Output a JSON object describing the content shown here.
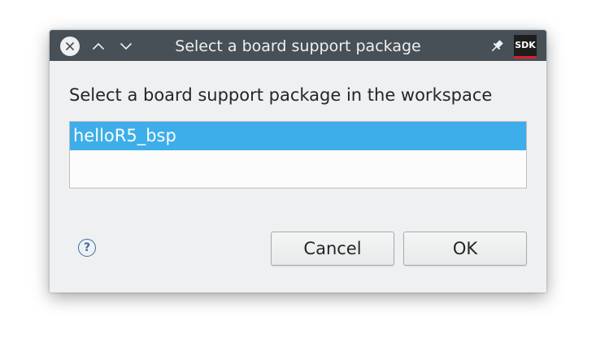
{
  "window": {
    "title": "Select a board support package",
    "app_icon_label": "SDK",
    "title_bar_icons": [
      "close-icon",
      "chevron-up-icon",
      "chevron-down-icon",
      "pin-icon"
    ]
  },
  "dialog": {
    "prompt": "Select a board support package in the workspace",
    "list": {
      "items": [
        {
          "label": "helloR5_bsp",
          "selected": true
        }
      ]
    },
    "help_glyph": "?",
    "cancel_label": "Cancel",
    "ok_label": "OK"
  },
  "colors": {
    "titlebar": "#475057",
    "dialog_bg": "#eff0f1",
    "selection": "#3daee9",
    "app_icon_accent": "#d9202a"
  }
}
